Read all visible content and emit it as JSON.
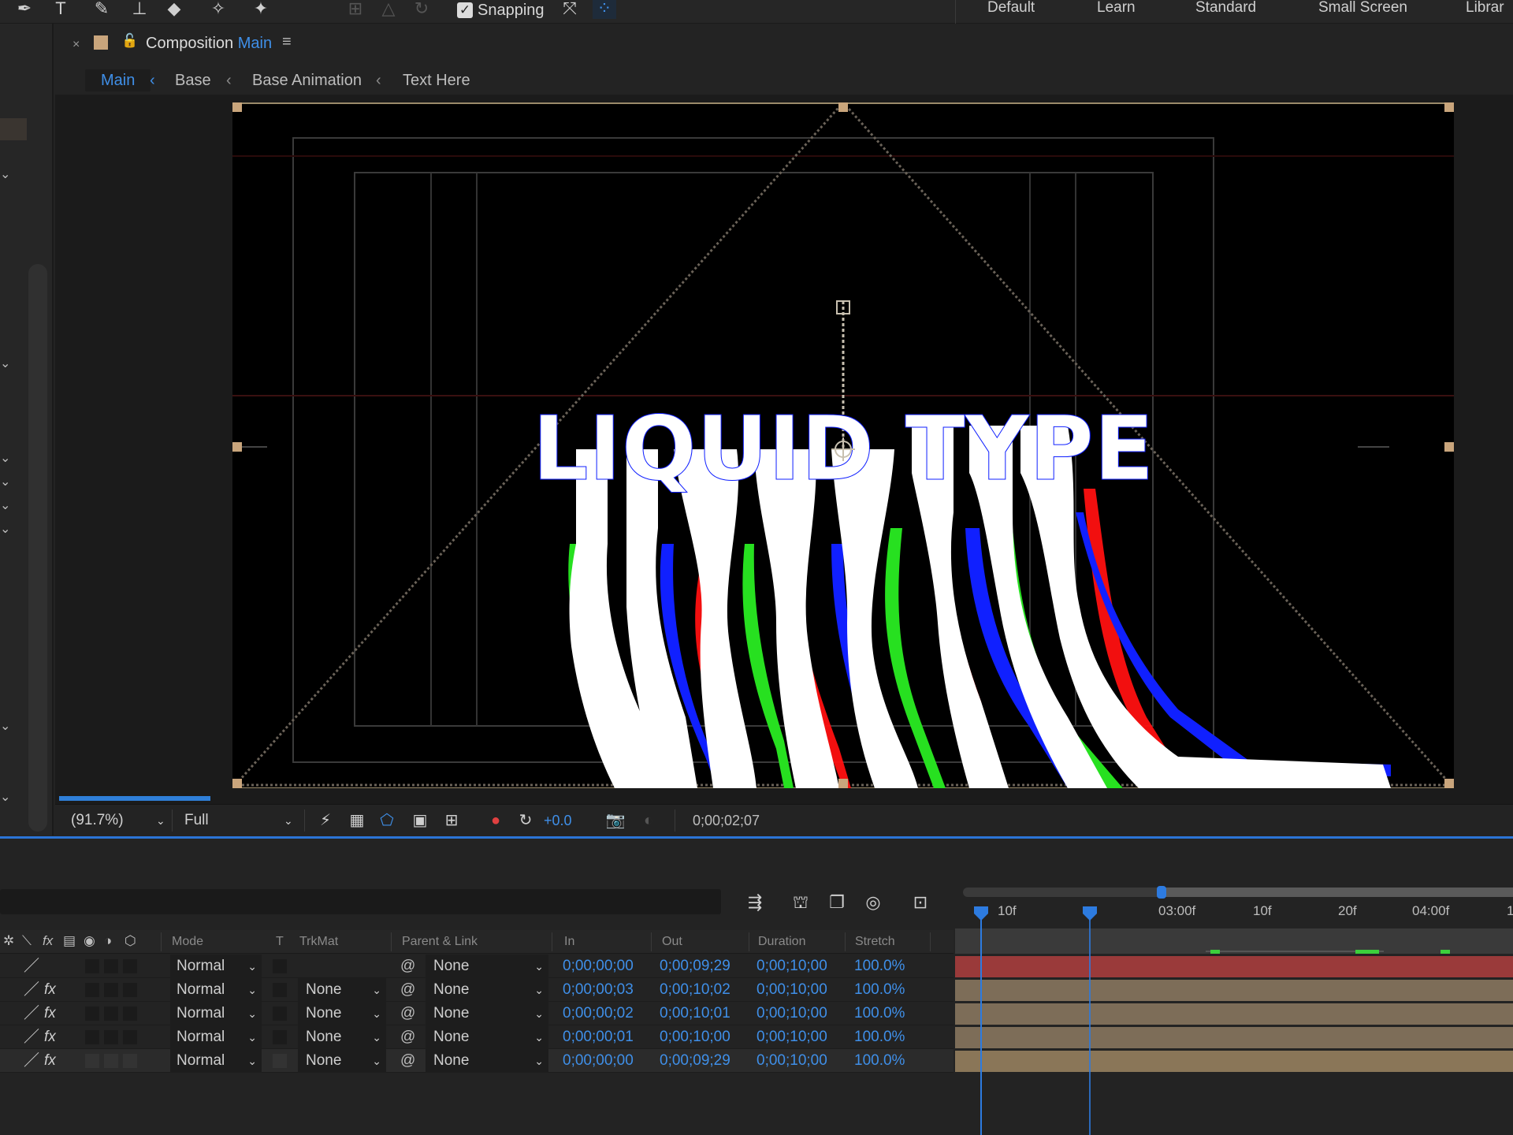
{
  "toolbar": {
    "tools": [
      "pen-tool-icon",
      "type-tool-icon",
      "brush-tool-icon",
      "clone-stamp-tool-icon",
      "eraser-tool-icon",
      "roto-brush-tool-icon",
      "puppet-pin-tool-icon"
    ],
    "snapping_label": "Snapping",
    "snapping_checked": true,
    "workspaces": [
      "Default",
      "Learn",
      "Standard",
      "Small Screen",
      "Librar"
    ]
  },
  "composition": {
    "tab_prefix": "Composition",
    "tab_name": "Main",
    "breadcrumbs": [
      "Main",
      "Base",
      "Base Animation",
      "Text Here"
    ],
    "canvas_text": "LIQUID TYPE"
  },
  "viewer_bar": {
    "zoom": "(91.7%)",
    "resolution": "Full",
    "exposure": "+0.0",
    "timecode": "0;00;02;07"
  },
  "timeline": {
    "columns": [
      "Mode",
      "T",
      "TrkMat",
      "Parent & Link",
      "In",
      "Out",
      "Duration",
      "Stretch"
    ],
    "ruler_ticks": [
      "10f",
      "03:00f",
      "10f",
      "20f",
      "04:00f",
      "1"
    ],
    "layers": [
      {
        "mode": "Normal",
        "trkmat": "",
        "parent": "None",
        "in": "0;00;00;00",
        "out": "0;00;09;29",
        "duration": "0;00;10;00",
        "stretch": "100.0%",
        "fx": false,
        "bar_color": "#9a3a3a"
      },
      {
        "mode": "Normal",
        "trkmat": "None",
        "parent": "None",
        "in": "0;00;00;03",
        "out": "0;00;10;02",
        "duration": "0;00;10;00",
        "stretch": "100.0%",
        "fx": true,
        "bar_color": "#7d6d58"
      },
      {
        "mode": "Normal",
        "trkmat": "None",
        "parent": "None",
        "in": "0;00;00;02",
        "out": "0;00;10;01",
        "duration": "0;00;10;00",
        "stretch": "100.0%",
        "fx": true,
        "bar_color": "#7d6d58"
      },
      {
        "mode": "Normal",
        "trkmat": "None",
        "parent": "None",
        "in": "0;00;00;01",
        "out": "0;00;10;00",
        "duration": "0;00;10;00",
        "stretch": "100.0%",
        "fx": true,
        "bar_color": "#7d6d58"
      },
      {
        "mode": "Normal",
        "trkmat": "None",
        "parent": "None",
        "in": "0;00;00;00",
        "out": "0;00;09;29",
        "duration": "0;00;10;00",
        "stretch": "100.0%",
        "fx": true,
        "bar_color": "#8a7658"
      }
    ]
  }
}
